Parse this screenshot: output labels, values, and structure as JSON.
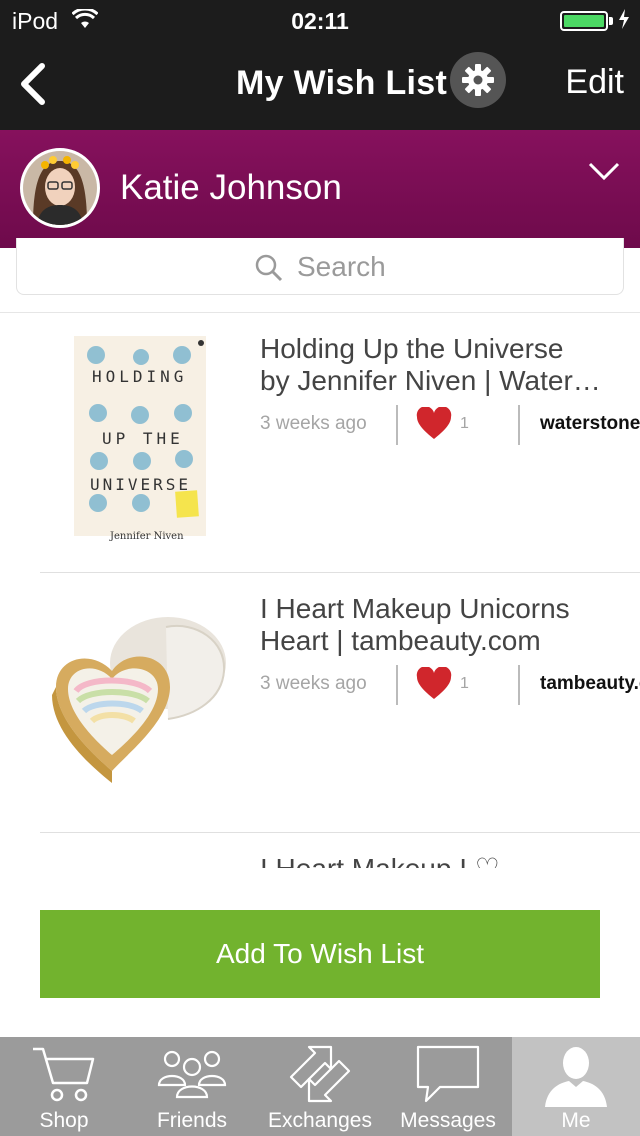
{
  "status_bar": {
    "carrier": "iPod",
    "time": "02:11",
    "battery_level": 1.0
  },
  "nav": {
    "back_icon": "chevron-left-icon",
    "title": "My Wish List",
    "settings_icon": "gear-icon",
    "edit_label": "Edit"
  },
  "user": {
    "name": "Katie Johnson",
    "dropdown_icon": "chevron-down-icon"
  },
  "search": {
    "placeholder": "Search"
  },
  "items": [
    {
      "title_line1": "Holding Up the Universe",
      "title_line2": "by Jennifer Niven | Water…",
      "time": "3 weeks ago",
      "likes": "1",
      "store": "waterstones.com",
      "image": {
        "kind": "book-cover",
        "words": [
          "HOLDING",
          "UP THE",
          "UNIVERSE"
        ],
        "author": "Jennifer Niven"
      }
    },
    {
      "title_line1": "I Heart Makeup Unicorns",
      "title_line2": "Heart | tambeauty.com",
      "time": "3 weeks ago",
      "likes": "1",
      "store": "tambeauty.com",
      "image": {
        "kind": "heart-highlighter-product"
      }
    }
  ],
  "partial_item_title": "I Heart Makeup I ♡",
  "add_button": "Add To Wish List",
  "tabs": [
    {
      "label": "Shop",
      "icon": "cart-icon"
    },
    {
      "label": "Friends",
      "icon": "friends-icon"
    },
    {
      "label": "Exchanges",
      "icon": "exchange-arrows-icon"
    },
    {
      "label": "Messages",
      "icon": "message-bubble-icon"
    },
    {
      "label": "Me",
      "icon": "person-icon",
      "active": true
    }
  ],
  "colors": {
    "nav_bg": "#1c1c1c",
    "user_bar": "#7a0d55",
    "accent_green": "#72b32e",
    "heart_red": "#d0262c",
    "tab_bg": "#9b9b9b",
    "tab_active": "#c2c2c2"
  }
}
